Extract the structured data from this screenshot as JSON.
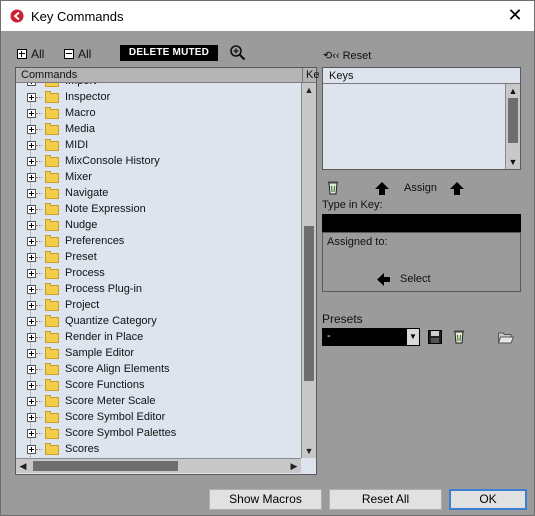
{
  "window": {
    "title": "Key Commands",
    "icons": {
      "app": "cubase-icon",
      "close": "close-icon"
    }
  },
  "toolbar": {
    "expand_all_label": "All",
    "collapse_all_label": "All",
    "delete_muted_label": "DELETE MUTED",
    "search_icon": "magnifier-plus-icon"
  },
  "commands": {
    "column_commands": "Commands",
    "column_keys": "Ke",
    "partial_top_item": "Import",
    "items": [
      "Inspector",
      "Macro",
      "Media",
      "MIDI",
      "MixConsole History",
      "Mixer",
      "Navigate",
      "Note Expression",
      "Nudge",
      "Preferences",
      "Preset",
      "Process",
      "Process Plug-in",
      "Project",
      "Quantize Category",
      "Render in Place",
      "Sample Editor",
      "Score Align Elements",
      "Score Functions",
      "Score Meter Scale",
      "Score Symbol Editor",
      "Score Symbol Palettes",
      "Scores"
    ]
  },
  "keys": {
    "reset_label": "Reset",
    "reset_icon": "reset-arrows-icon",
    "column_keys": "Keys",
    "assign_label": "Assign",
    "type_in_key_label": "Type in Key:",
    "type_in_key_value": "",
    "assigned_to_label": "Assigned to:",
    "select_label": "Select"
  },
  "presets": {
    "label": "Presets",
    "selected": "-",
    "icons": [
      "save-icon",
      "delete-icon",
      "folder-open-icon"
    ]
  },
  "buttons": {
    "show_macros": "Show Macros",
    "reset_all": "Reset All",
    "ok": "OK"
  },
  "colors": {
    "tree_background": "#dde4ee",
    "folder": "#f2cc4a",
    "ok_border": "#3c7fd0",
    "app_icon": "#c8202e"
  }
}
